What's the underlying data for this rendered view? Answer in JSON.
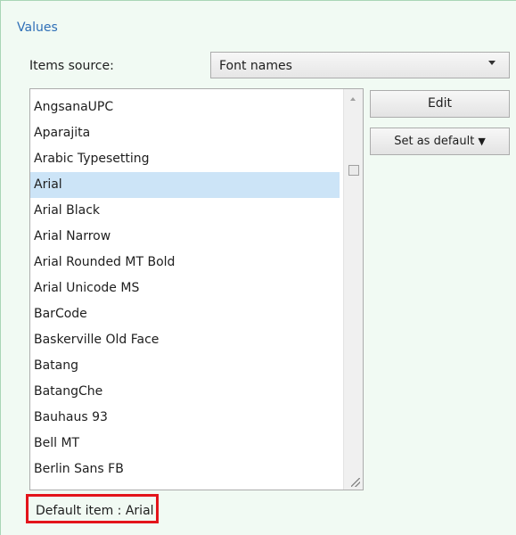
{
  "section": {
    "title": "Values"
  },
  "items_source": {
    "label": "Items source:",
    "value": "Font names"
  },
  "list": {
    "items": [
      "AngsanaUPC",
      "Aparajita",
      "Arabic Typesetting",
      "Arial",
      "Arial Black",
      "Arial Narrow",
      "Arial Rounded MT Bold",
      "Arial Unicode MS",
      "BarCode",
      "Baskerville Old Face",
      "Batang",
      "BatangChe",
      "Bauhaus 93",
      "Bell MT",
      "Berlin Sans FB"
    ],
    "selected": "Arial"
  },
  "buttons": {
    "edit": "Edit",
    "set_default": "Set as default",
    "set_default_icon": "caret-down-icon"
  },
  "status": {
    "default_item": "Default item : Arial"
  },
  "colors": {
    "section_title": "#2e6fb7",
    "selection": "#cce4f7",
    "highlight_border": "#e3141b",
    "panel_background": "#f1faf3"
  }
}
